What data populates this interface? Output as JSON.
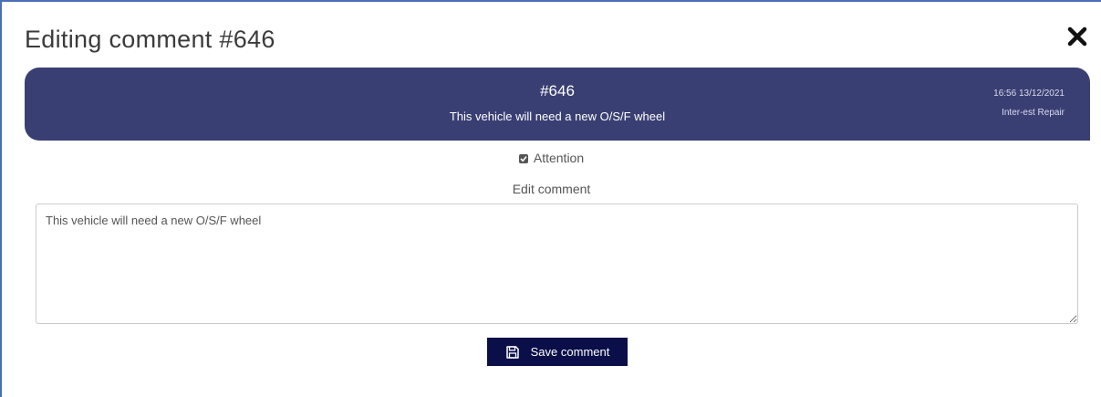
{
  "modal": {
    "title": "Editing comment #646",
    "close_icon": "close-x-icon"
  },
  "comment_card": {
    "number": "#646",
    "text": "This vehicle will need a new O/S/F wheel",
    "timestamp": "16:56 13/12/2021",
    "author": "Inter-est Repair",
    "background_color": "#3a3f73"
  },
  "attention": {
    "label": "Attention",
    "checked": true
  },
  "edit": {
    "label": "Edit comment",
    "value": "This vehicle will need a new O/S/F wheel"
  },
  "save": {
    "label": "Save comment",
    "icon": "floppy-disk-icon",
    "background_color": "#0a0f4a"
  }
}
